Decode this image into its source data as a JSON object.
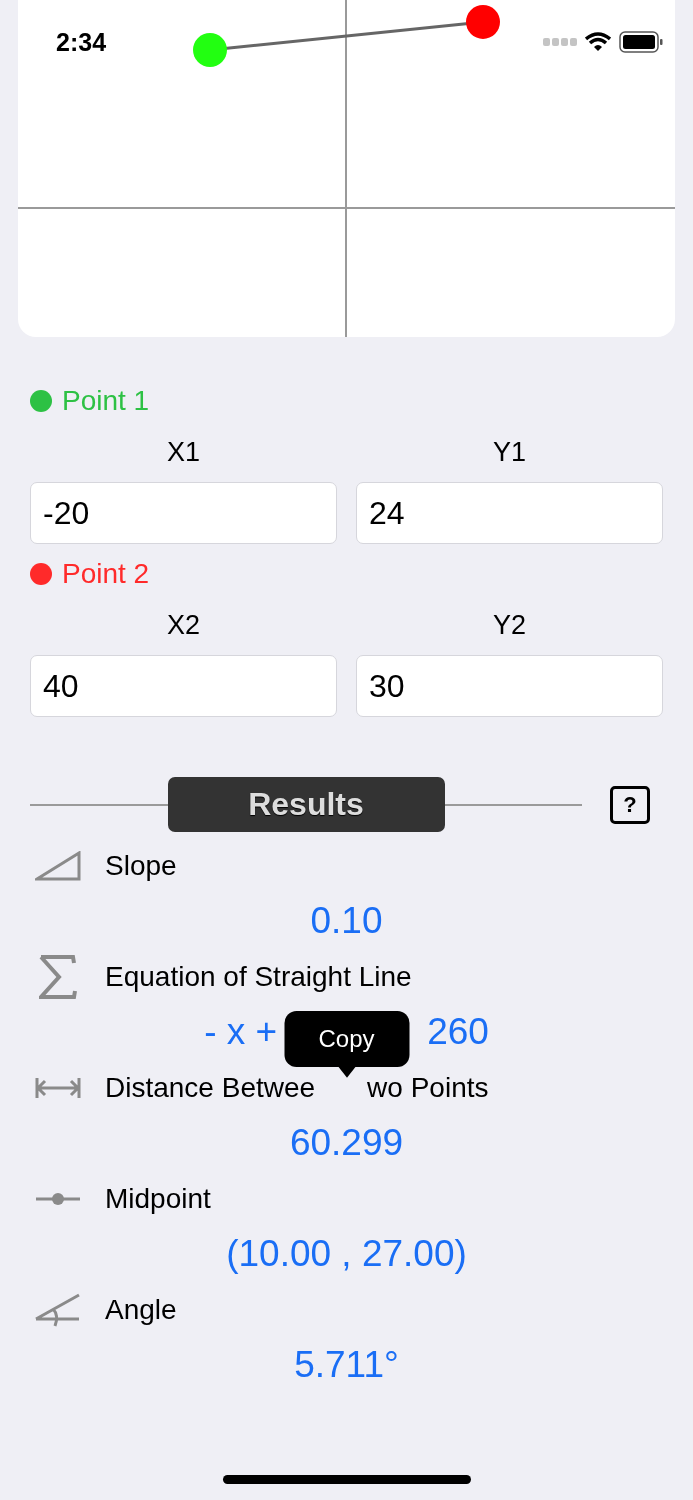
{
  "status_bar": {
    "time": "2:34"
  },
  "graph": {
    "points": [
      {
        "color": "#22ff11"
      },
      {
        "color": "#ff0000"
      }
    ]
  },
  "points": [
    {
      "title": "Point 1",
      "color": "#2dc144",
      "fields": [
        {
          "label": "X1",
          "value": "-20"
        },
        {
          "label": "Y1",
          "value": "24"
        }
      ]
    },
    {
      "title": "Point 2",
      "color": "#ff2a2a",
      "fields": [
        {
          "label": "X2",
          "value": "40"
        },
        {
          "label": "Y2",
          "value": "30"
        }
      ]
    }
  ],
  "results": {
    "title": "Results",
    "help": "?",
    "items": [
      {
        "kind": "slope",
        "label_parts": [
          "Slope"
        ],
        "value_parts": [
          "0.10"
        ]
      },
      {
        "kind": "sum",
        "label_parts": [
          "Equation of Straight Line"
        ],
        "value_parts": [
          "- x +",
          "260"
        ],
        "tooltip": "Copy"
      },
      {
        "kind": "distance",
        "label_parts": [
          "Distance Betwee",
          "wo Points"
        ],
        "value_parts": [
          "60.299"
        ]
      },
      {
        "kind": "midpoint",
        "label_parts": [
          "Midpoint"
        ],
        "value_parts": [
          "(10.00 , 27.00)"
        ]
      },
      {
        "kind": "angle",
        "label_parts": [
          "Angle"
        ],
        "value_parts": [
          "5.711°"
        ]
      }
    ]
  }
}
